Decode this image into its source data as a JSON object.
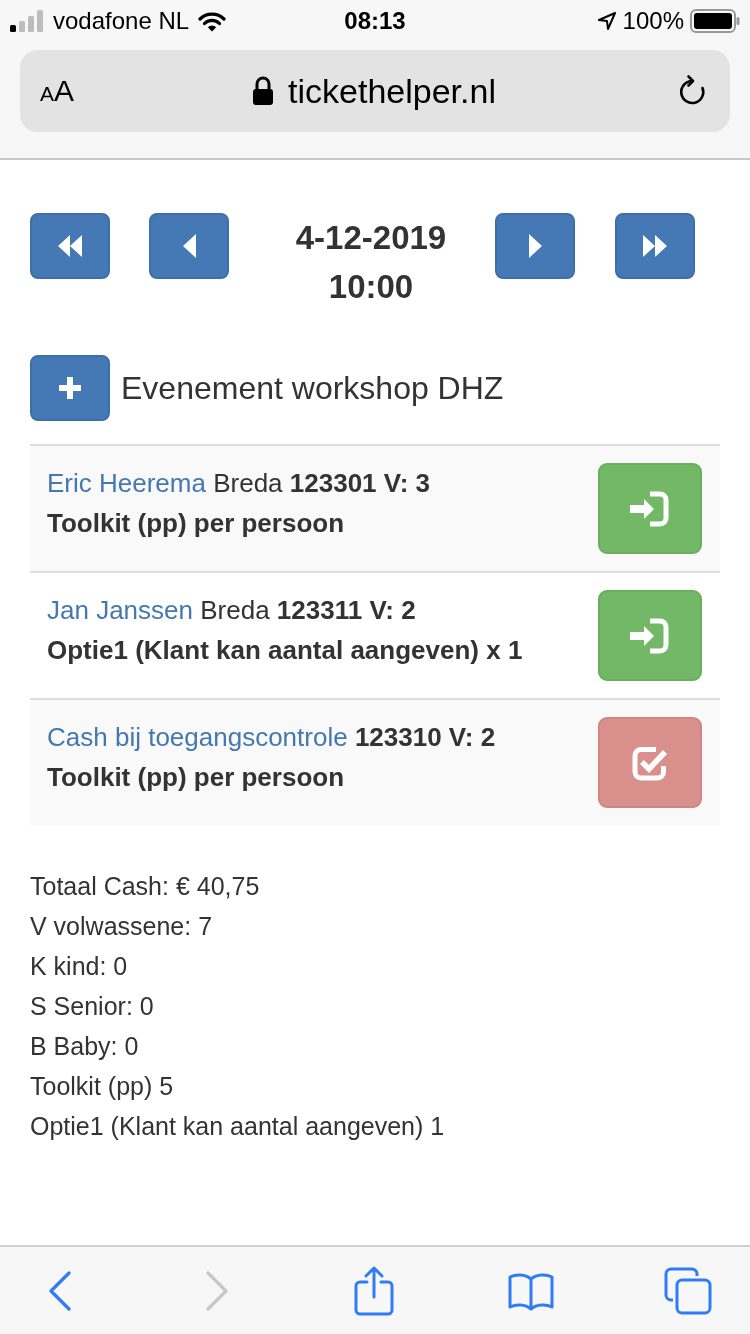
{
  "status_bar": {
    "carrier": "vodafone NL",
    "time": "08:13",
    "battery": "100%"
  },
  "address_bar": {
    "text_size_button": [
      "A",
      "A"
    ],
    "url": "tickethelper.nl"
  },
  "date_nav": {
    "date": "4-12-2019",
    "time": "10:00"
  },
  "event": {
    "title": "Evenement workshop DHZ"
  },
  "bookings": [
    {
      "name": "Eric Heerema",
      "city": "Breda",
      "ticket": "123301 V: 3",
      "product": "Toolkit (pp) per persoon",
      "kind": "checkin"
    },
    {
      "name": "Jan Janssen",
      "city": "Breda",
      "ticket": "123311 V: 2",
      "product": "Optie1 (Klant kan aantal aangeven) x 1",
      "kind": "checkin"
    },
    {
      "name": "Cash bij toegangscontrole",
      "ticket": "123310 V: 2",
      "product": "Toolkit (pp) per persoon",
      "kind": "paid"
    }
  ],
  "summary": [
    "Totaal Cash: € 40,75",
    "V volwassene: 7",
    "K kind: 0",
    "S Senior: 0",
    "B Baby: 0",
    "Toolkit (pp) 5",
    "Optie1 (Klant kan aantal aangeven) 1"
  ],
  "toolbar": [
    {
      "kind": "back",
      "disabled": false
    },
    {
      "kind": "forward",
      "disabled": true
    },
    {
      "kind": "share",
      "disabled": false
    },
    {
      "kind": "bookmarks",
      "disabled": false
    },
    {
      "kind": "tabs",
      "disabled": false
    }
  ]
}
